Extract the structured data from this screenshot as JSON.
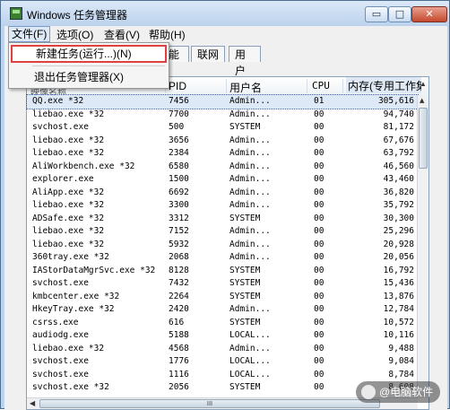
{
  "window": {
    "title": "Windows 任务管理器"
  },
  "controls": {
    "minimize": "▭",
    "maximize": "□",
    "close": "✕"
  },
  "menubar": {
    "file": "文件(F)",
    "options": "选项(O)",
    "view": "查看(V)",
    "help": "帮助(H)"
  },
  "file_menu": {
    "new_task": "新建任务(运行...)(N)",
    "exit": "退出任务管理器(X)"
  },
  "tabs": {
    "performance": "能",
    "networking": "联网",
    "users": "用户"
  },
  "columns": {
    "name": "映像名称",
    "pid": "PID",
    "user": "用户名",
    "cpu": "CPU",
    "mem": "内存(专用工作集)"
  },
  "processes": [
    {
      "name": "QQ.exe *32",
      "pid": "7456",
      "user": "Admin...",
      "cpu": "01",
      "mem": "305,616"
    },
    {
      "name": "liebao.exe *32",
      "pid": "7700",
      "user": "Admin...",
      "cpu": "00",
      "mem": "94,740"
    },
    {
      "name": "svchost.exe",
      "pid": "500",
      "user": "SYSTEM",
      "cpu": "00",
      "mem": "81,172"
    },
    {
      "name": "liebao.exe *32",
      "pid": "3656",
      "user": "Admin...",
      "cpu": "00",
      "mem": "67,676"
    },
    {
      "name": "liebao.exe *32",
      "pid": "2384",
      "user": "Admin...",
      "cpu": "00",
      "mem": "63,792"
    },
    {
      "name": "AliWorkbench.exe *32",
      "pid": "6580",
      "user": "Admin...",
      "cpu": "00",
      "mem": "46,560"
    },
    {
      "name": "explorer.exe",
      "pid": "1500",
      "user": "Admin...",
      "cpu": "00",
      "mem": "43,460"
    },
    {
      "name": "AliApp.exe *32",
      "pid": "6692",
      "user": "Admin...",
      "cpu": "00",
      "mem": "36,820"
    },
    {
      "name": "liebao.exe *32",
      "pid": "3300",
      "user": "Admin...",
      "cpu": "00",
      "mem": "35,792"
    },
    {
      "name": "ADSafe.exe *32",
      "pid": "3312",
      "user": "SYSTEM",
      "cpu": "00",
      "mem": "30,300"
    },
    {
      "name": "liebao.exe *32",
      "pid": "7152",
      "user": "Admin...",
      "cpu": "00",
      "mem": "25,296"
    },
    {
      "name": "liebao.exe *32",
      "pid": "5932",
      "user": "Admin...",
      "cpu": "00",
      "mem": "20,928"
    },
    {
      "name": "360tray.exe *32",
      "pid": "2068",
      "user": "Admin...",
      "cpu": "00",
      "mem": "20,056"
    },
    {
      "name": "IAStorDataMgrSvc.exe *32",
      "pid": "8128",
      "user": "SYSTEM",
      "cpu": "00",
      "mem": "16,792"
    },
    {
      "name": "svchost.exe",
      "pid": "7432",
      "user": "SYSTEM",
      "cpu": "00",
      "mem": "15,436"
    },
    {
      "name": "kmbcenter.exe *32",
      "pid": "2264",
      "user": "SYSTEM",
      "cpu": "00",
      "mem": "13,876"
    },
    {
      "name": "HkeyTray.exe *32",
      "pid": "2420",
      "user": "Admin...",
      "cpu": "00",
      "mem": "12,784"
    },
    {
      "name": "csrss.exe",
      "pid": "616",
      "user": "SYSTEM",
      "cpu": "00",
      "mem": "10,572"
    },
    {
      "name": "audiodg.exe",
      "pid": "5188",
      "user": "LOCAL...",
      "cpu": "00",
      "mem": "10,116"
    },
    {
      "name": "liebao.exe *32",
      "pid": "4568",
      "user": "Admin...",
      "cpu": "00",
      "mem": "9,488"
    },
    {
      "name": "svchost.exe",
      "pid": "1776",
      "user": "LOCAL...",
      "cpu": "00",
      "mem": "9,084"
    },
    {
      "name": "svchost.exe",
      "pid": "1116",
      "user": "LOCAL...",
      "cpu": "00",
      "mem": "8,784"
    },
    {
      "name": "svchost.exe *32",
      "pid": "2056",
      "user": "SYSTEM",
      "cpu": "00",
      "mem": "8,608"
    }
  ],
  "scroll": {
    "hthumb_grip": "III"
  },
  "watermark": {
    "text": "@电脑软件"
  }
}
